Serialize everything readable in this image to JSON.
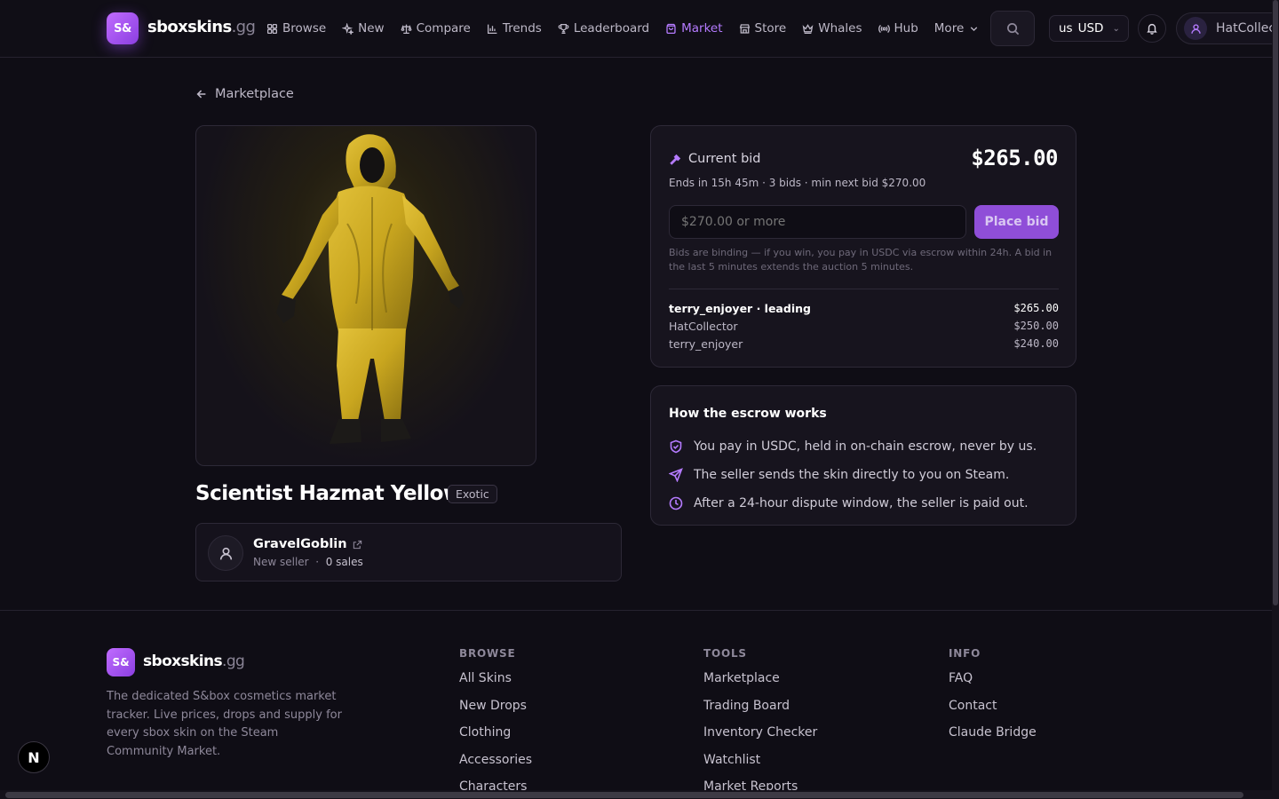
{
  "nav": {
    "logo_badge": "S&",
    "logo_name": "sboxskins",
    "logo_tld": ".gg",
    "items": [
      {
        "label": "Browse",
        "icon": "grid-icon"
      },
      {
        "label": "New",
        "icon": "sparkle-icon"
      },
      {
        "label": "Compare",
        "icon": "scale-icon"
      },
      {
        "label": "Trends",
        "icon": "bar-chart-icon"
      },
      {
        "label": "Leaderboard",
        "icon": "trophy-icon"
      },
      {
        "label": "Market",
        "icon": "shopping-bag-icon",
        "active": true
      },
      {
        "label": "Store",
        "icon": "store-icon"
      },
      {
        "label": "Whales",
        "icon": "crown-icon"
      },
      {
        "label": "Hub",
        "icon": "radio-icon"
      },
      {
        "label": "More",
        "icon": "chevron-down-icon"
      }
    ],
    "currency_flag": "us",
    "currency": "USD",
    "username": "HatCollector"
  },
  "back_label": "Marketplace",
  "item": {
    "title": "Scientist Hazmat Yellow",
    "rarity": "Exotic"
  },
  "seller": {
    "name": "GravelGoblin",
    "status": "New seller",
    "separator": "·",
    "sales": "0 sales"
  },
  "bid": {
    "heading": "Current bid",
    "price": "$265.00",
    "subtitle": "Ends in 15h 45m · 3 bids · min next bid $270.00",
    "input_placeholder": "$270.00 or more",
    "button_label": "Place bid",
    "note": "Bids are binding — if you win, you pay in USDC via escrow within 24h. A bid in the last 5 minutes extends the auction 5 minutes.",
    "history": [
      {
        "who": "terry_enjoyer · leading",
        "amount": "$265.00",
        "leading": true
      },
      {
        "who": "HatCollector",
        "amount": "$250.00"
      },
      {
        "who": "terry_enjoyer",
        "amount": "$240.00"
      }
    ]
  },
  "escrow": {
    "title": "How the escrow works",
    "steps": [
      {
        "text": "You pay in USDC, held in on-chain escrow, never by us.",
        "icon": "shield-check-icon"
      },
      {
        "text": "The seller sends the skin directly to you on Steam.",
        "icon": "send-icon"
      },
      {
        "text": "After a 24-hour dispute window, the seller is paid out.",
        "icon": "clock-icon"
      }
    ]
  },
  "footer": {
    "logo_badge": "S&",
    "logo_name": "sboxskins",
    "logo_tld": ".gg",
    "description": "The dedicated S&box cosmetics market tracker. Live prices, drops and supply for every sbox skin on the Steam Community Market.",
    "columns": [
      {
        "title": "BROWSE",
        "links": [
          "All Skins",
          "New Drops",
          "Clothing",
          "Accessories",
          "Characters"
        ]
      },
      {
        "title": "TOOLS",
        "links": [
          "Marketplace",
          "Trading Board",
          "Inventory Checker",
          "Watchlist",
          "Market Reports"
        ]
      },
      {
        "title": "INFO",
        "links": [
          "FAQ",
          "Contact",
          "Claude Bridge"
        ]
      }
    ]
  },
  "dev_badge": "N",
  "colors": {
    "accent": "#b57bff",
    "button": "#8f4ed8",
    "background": "#0f0d15",
    "card": "#17141e"
  }
}
